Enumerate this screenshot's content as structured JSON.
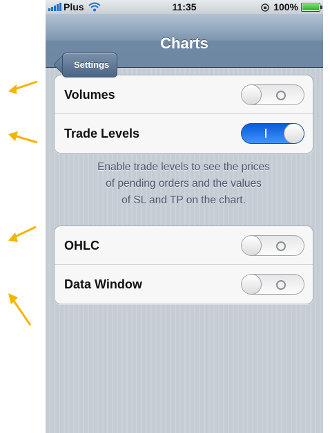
{
  "status_bar": {
    "carrier": "Plus",
    "time": "11:35",
    "battery": "100%",
    "battery_level": 1.0,
    "signal_icon": "signal-bars-icon",
    "wifi_icon": "wifi-icon",
    "orientation_lock_icon": "orientation-lock-icon"
  },
  "nav": {
    "back_label": "Settings",
    "title": "Charts"
  },
  "groups": [
    {
      "rows": [
        {
          "label": "Volumes",
          "on": false
        },
        {
          "label": "Trade Levels",
          "on": true
        }
      ],
      "footer": "Enable trade levels to see the prices\nof pending orders and the values\nof SL and TP on the chart."
    },
    {
      "rows": [
        {
          "label": "OHLC",
          "on": false
        },
        {
          "label": "Data Window",
          "on": false
        }
      ]
    }
  ],
  "colors": {
    "annotation_arrow": "#f5b400",
    "switch_on": "#1f73e8",
    "nav_bar": "#7f97b1"
  }
}
